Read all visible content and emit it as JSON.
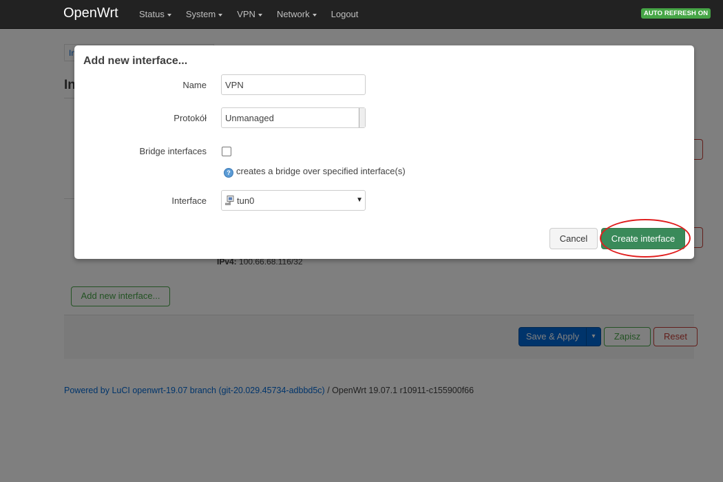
{
  "app": {
    "brand": "OpenWrt",
    "auto_refresh": "AUTO REFRESH ON",
    "menu": [
      {
        "label": "Status",
        "has_caret": true
      },
      {
        "label": "System",
        "has_caret": true
      },
      {
        "label": "VPN",
        "has_caret": true
      },
      {
        "label": "Network",
        "has_caret": true
      },
      {
        "label": "Logout",
        "has_caret": false
      }
    ]
  },
  "background": {
    "tab_label": "In",
    "heading": "In",
    "ipv4_label": "IPv4:",
    "ipv4_value": "100.66.68.116/32",
    "add_interface_button": "Add new interface...",
    "save_apply_button": "Save & Apply",
    "save_apply_dropdown": "▾",
    "zapisz_button": "Zapisz",
    "reset_button": "Reset",
    "footer_link": "Powered by LuCI openwrt-19.07 branch (git-20.029.45734-adbbd5c)",
    "footer_sep": " / ",
    "footer_version": "OpenWrt 19.07.1 r10911-c155900f66"
  },
  "modal": {
    "title": "Add new interface...",
    "name_label": "Name",
    "name_value": "VPN",
    "protocol_label": "Protokół",
    "protocol_value": "Unmanaged",
    "bridge_label": "Bridge interfaces",
    "bridge_checked": false,
    "bridge_help": "creates a bridge over specified interface(s)",
    "help_icon": "?",
    "interface_label": "Interface",
    "interface_value": "tun0",
    "cancel_button": "Cancel",
    "create_button": "Create interface"
  },
  "colors": {
    "topbar": "#222222",
    "primary": "#0069d6",
    "success": "#46a546",
    "danger": "#c43c35",
    "create_button": "#3a8a5a",
    "highlight": "#e01e1e"
  }
}
